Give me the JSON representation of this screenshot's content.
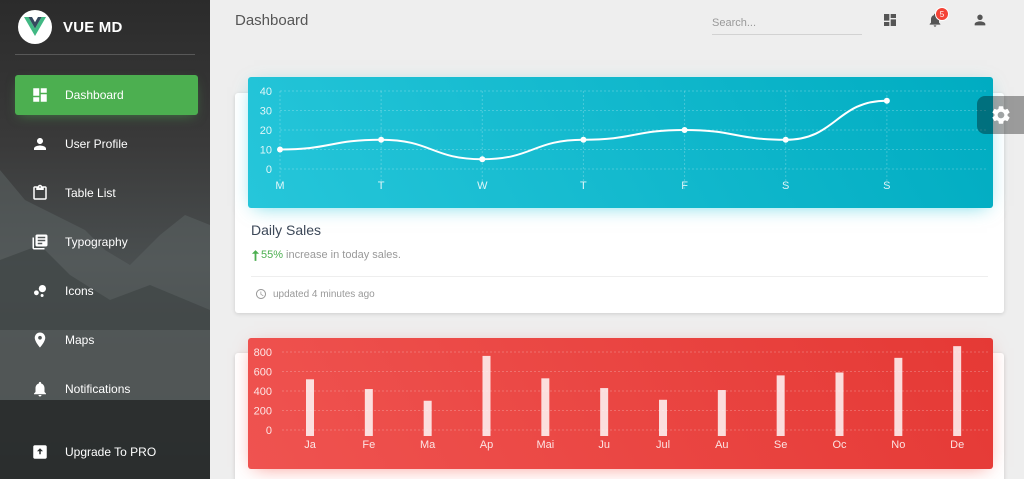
{
  "brand": {
    "name": "VUE MD"
  },
  "sidebar": {
    "items": [
      {
        "label": "Dashboard",
        "icon": "dashboard-icon",
        "active": true
      },
      {
        "label": "User Profile",
        "icon": "person-icon"
      },
      {
        "label": "Table List",
        "icon": "clipboard-icon"
      },
      {
        "label": "Typography",
        "icon": "library-books-icon"
      },
      {
        "label": "Icons",
        "icon": "bubble-chart-icon"
      },
      {
        "label": "Maps",
        "icon": "location-pin-icon"
      },
      {
        "label": "Notifications",
        "icon": "bell-icon"
      }
    ],
    "upgrade": {
      "label": "Upgrade To PRO",
      "icon": "unarchive-icon"
    }
  },
  "topbar": {
    "title": "Dashboard",
    "search_placeholder": "Search...",
    "notification_count": "5",
    "icons": [
      "dashboard-icon",
      "bell-icon",
      "person-icon"
    ]
  },
  "daily_sales": {
    "title": "Daily Sales",
    "percent": "55%",
    "description": "increase in today sales.",
    "footer": "updated 4 minutes ago",
    "color": "#00bcd4"
  },
  "email_subs": {
    "color": "#f44336"
  },
  "chart_data": [
    {
      "type": "line",
      "categories": [
        "M",
        "T",
        "W",
        "T",
        "F",
        "S",
        "S"
      ],
      "values": [
        10,
        15,
        5,
        15,
        20,
        15,
        35
      ],
      "yticks": [
        0,
        10,
        20,
        30,
        40
      ],
      "ylim": [
        0,
        40
      ],
      "grid": true
    },
    {
      "type": "bar",
      "categories": [
        "Ja",
        "Fe",
        "Ma",
        "Ap",
        "Mai",
        "Ju",
        "Jul",
        "Au",
        "Se",
        "Oc",
        "No",
        "De"
      ],
      "values": [
        520,
        420,
        300,
        760,
        530,
        430,
        310,
        410,
        560,
        590,
        740,
        860
      ],
      "yticks": [
        0,
        200,
        400,
        600,
        800
      ],
      "ylim": [
        0,
        800
      ],
      "grid": true
    }
  ]
}
